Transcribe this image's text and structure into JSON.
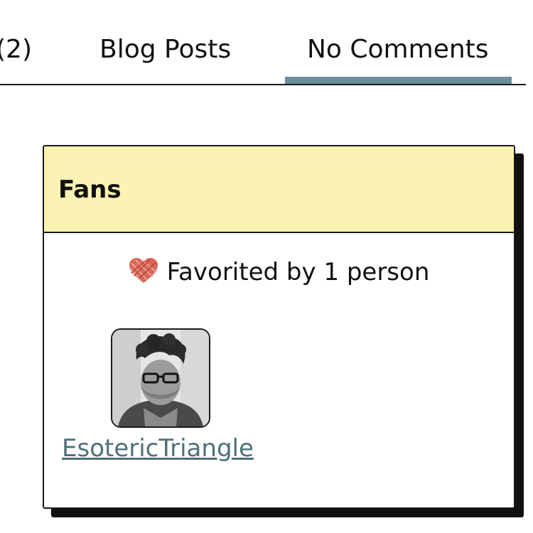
{
  "tabs": [
    {
      "label": "(2)"
    },
    {
      "label": "Blog Posts"
    },
    {
      "label": "No Comments",
      "active": true
    }
  ],
  "colors": {
    "tab_indicator": "#6a8f9a",
    "card_header_bg": "#faf3b3",
    "link": "#4f7078",
    "heart": "#d9685a"
  },
  "fans_card": {
    "title": "Fans",
    "favorited_text": "Favorited by 1 person",
    "heart_icon": "yarn-heart-icon",
    "fans": [
      {
        "name": "EsotericTriangle"
      }
    ]
  }
}
